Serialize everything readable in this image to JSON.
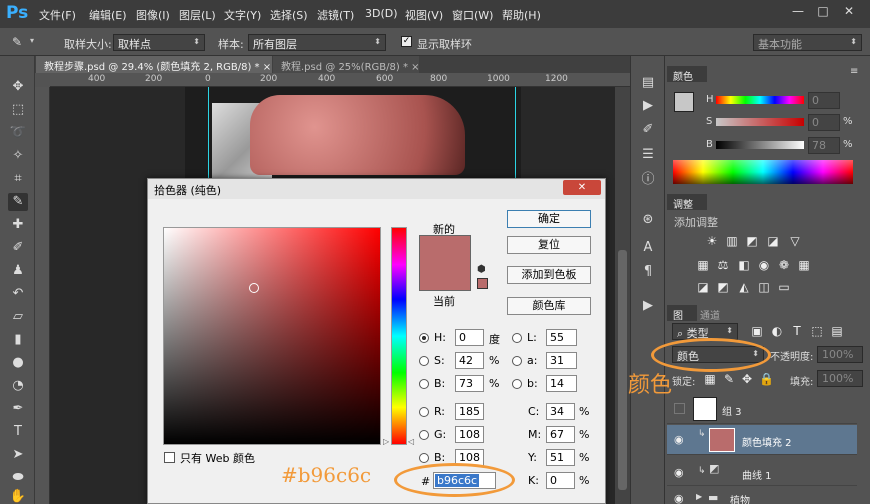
{
  "app": {
    "logo": "Ps",
    "menus": [
      "文件(F)",
      "编辑(E)",
      "图像(I)",
      "图层(L)",
      "文字(Y)",
      "选择(S)",
      "滤镜(T)",
      "3D(D)",
      "视图(V)",
      "窗口(W)",
      "帮助(H)"
    ],
    "window_buttons": [
      "—",
      "□",
      "✕"
    ]
  },
  "options_bar": {
    "sample_size_label": "取样大小:",
    "sample_size_value": "取样点",
    "sample_label": "样本:",
    "sample_value": "所有图层",
    "show_ring_label": "显示取样环",
    "workspace": "基本功能"
  },
  "tabs": [
    {
      "title": "教程步骤.psd @ 29.4% (颜色填充 2, RGB/8) *",
      "close": "×"
    },
    {
      "title": "教程.psd @ 25%(RGB/8) *",
      "close": "×"
    }
  ],
  "ruler": {
    "ticks": [
      "400",
      "200",
      "0",
      "200",
      "400",
      "600",
      "800",
      "1000",
      "1200"
    ]
  },
  "panels": {
    "color": {
      "tab": "颜色",
      "rows": [
        {
          "label": "H",
          "value": "0",
          "unit": ""
        },
        {
          "label": "S",
          "value": "0",
          "unit": "%"
        },
        {
          "label": "B",
          "value": "78",
          "unit": "%"
        }
      ]
    },
    "adjustments": {
      "tab": "调整",
      "add_label": "添加调整"
    },
    "layers": {
      "tabs": [
        "图层",
        "通道"
      ],
      "kind_filter": "类型",
      "blend_mode": "颜色",
      "opacity_label": "不透明度:",
      "opacity_value": "100%",
      "lock_label": "锁定:",
      "fill_label": "填充:",
      "fill_value": "100%",
      "items": [
        {
          "name": "组 3",
          "selected": false
        },
        {
          "name": "颜色填充 2",
          "selected": true
        },
        {
          "name": "曲线 1",
          "selected": false
        },
        {
          "name": "植物",
          "selected": false
        }
      ]
    }
  },
  "dialog": {
    "title": "拾色器 (纯色)",
    "new_label": "新的",
    "current_label": "当前",
    "buttons": {
      "ok": "确定",
      "reset": "复位",
      "add_swatch": "添加到色板",
      "libraries": "颜色库"
    },
    "web_only": "只有 Web 颜色",
    "hsb": [
      {
        "label": "H:",
        "value": "0",
        "unit": "度",
        "checked": true
      },
      {
        "label": "S:",
        "value": "42",
        "unit": "%",
        "checked": false
      },
      {
        "label": "B:",
        "value": "73",
        "unit": "%",
        "checked": false
      }
    ],
    "rgb": [
      {
        "label": "R:",
        "value": "185"
      },
      {
        "label": "G:",
        "value": "108"
      },
      {
        "label": "B:",
        "value": "108"
      }
    ],
    "lab": [
      {
        "label": "L:",
        "value": "55"
      },
      {
        "label": "a:",
        "value": "31"
      },
      {
        "label": "b:",
        "value": "14"
      }
    ],
    "cmyk": [
      {
        "label": "C:",
        "value": "34",
        "unit": "%"
      },
      {
        "label": "M:",
        "value": "67",
        "unit": "%"
      },
      {
        "label": "Y:",
        "value": "51",
        "unit": "%"
      },
      {
        "label": "K:",
        "value": "0",
        "unit": "%"
      }
    ],
    "hex_label": "#",
    "hex_value": "b96c6c"
  },
  "annotations": {
    "hex_note": "#b96c6c",
    "blend_note": "颜色"
  },
  "colors": {
    "selected": "#b96c6c",
    "accent": "#f29a3a"
  }
}
